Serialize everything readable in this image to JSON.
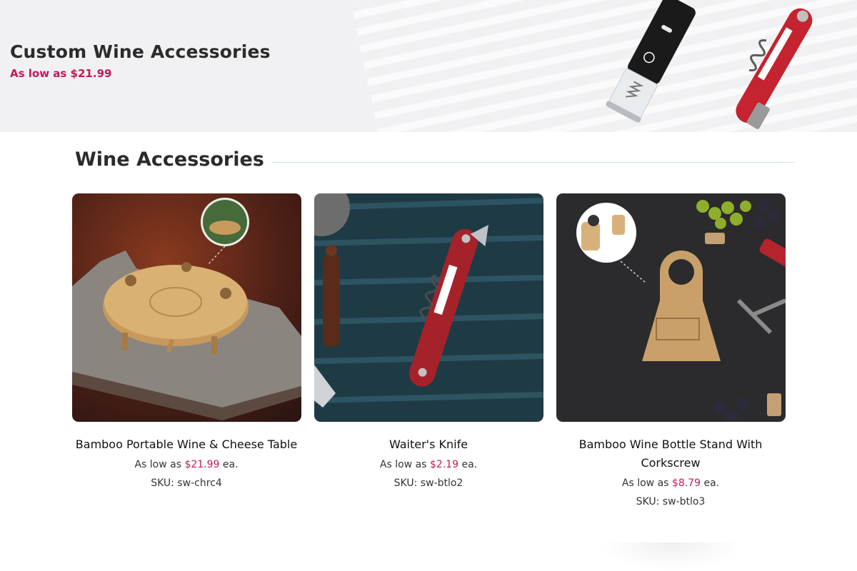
{
  "hero": {
    "title": "Custom Wine Accessories",
    "subtitle": "As low as $21.99"
  },
  "section": {
    "heading": "Wine Accessories"
  },
  "products": [
    {
      "name": "Bamboo Portable Wine & Cheese Table",
      "price_prefix": "As low as ",
      "price": "$21.99",
      "price_suffix": " ea.",
      "sku": "SKU: sw-chrc4"
    },
    {
      "name": "Waiter's Knife",
      "price_prefix": "As low as ",
      "price": "$2.19",
      "price_suffix": " ea.",
      "sku": "SKU: sw-btlo2"
    },
    {
      "name": "Bamboo Wine Bottle Stand With Corkscrew",
      "price_prefix": "As low as ",
      "price": "$8.79",
      "price_suffix": " ea.",
      "sku": "SKU: sw-btlo3"
    }
  ],
  "colors": {
    "accent": "#c4185c",
    "heading": "#2b2b2b",
    "hero_bg": "#f1f1f3"
  },
  "icons": {
    "hero_left": "electric-wine-opener-icon",
    "hero_right": "red-corkscrew-icon"
  }
}
